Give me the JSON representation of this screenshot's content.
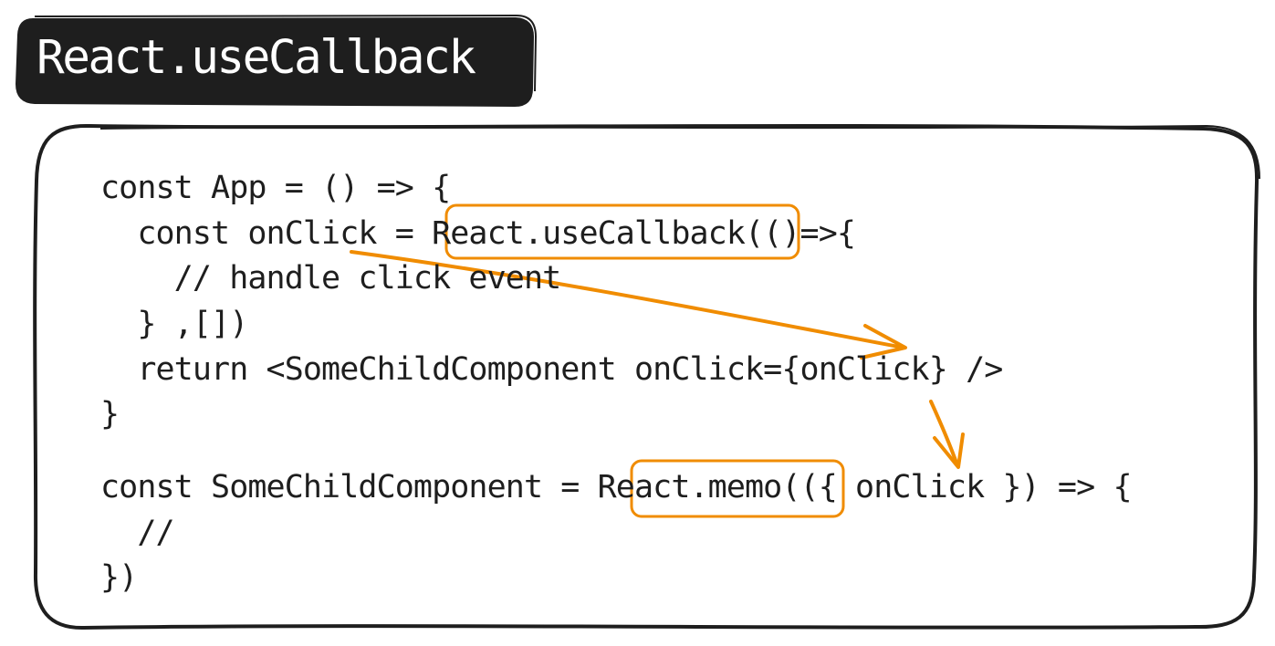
{
  "title": "React.useCallback",
  "code_lines": [
    "const App = () => {",
    "  const onClick = React.useCallback(()=>{",
    "    // handle click event",
    "  } ,[])",
    "  return <SomeChildComponent onClick={onClick} />",
    "}",
    "",
    "const SomeChildComponent = React.memo(({ onClick }) => {",
    "  //",
    "})"
  ],
  "highlights": [
    "React.useCallback",
    "React.memo"
  ],
  "colors": {
    "title_background": "#1e1e1e",
    "title_text": "#ffffff",
    "frame_stroke": "#1e1e1e",
    "code_text": "#1e1e1e",
    "highlight": "#f08c00"
  }
}
